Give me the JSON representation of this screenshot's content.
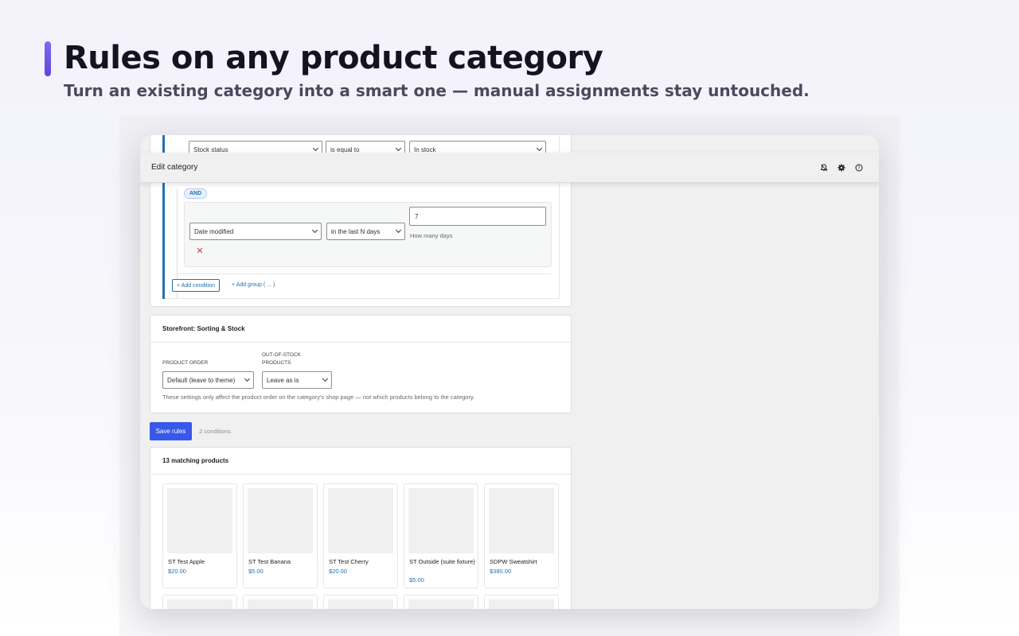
{
  "hero": {
    "title": "Rules on any product category",
    "subtitle": "Turn an existing category into a smart one — manual assignments stay untouched."
  },
  "topbar": {
    "title": "Edit category",
    "icons": [
      "bell-icon",
      "gear-icon",
      "help-icon"
    ]
  },
  "rules": {
    "condition1": {
      "field": "Stock status",
      "operator": "is equal to",
      "value": "In stock"
    },
    "and_label": "AND",
    "condition2": {
      "field": "Date modified",
      "operator": "in the last N days",
      "value": "7",
      "help": "How many days"
    },
    "add_condition": "+ Add condition",
    "add_group": "+ Add group ( ... )"
  },
  "storefront": {
    "heading": "Storefront: Sorting & Stock",
    "product_order_label": "PRODUCT ORDER",
    "product_order_value": "Default (leave to theme)",
    "oos_label_line1": "OUT-OF-STOCK",
    "oos_label_line2": "PRODUCTS",
    "oos_value": "Leave as is",
    "note": "These settings only affect the product order on the category's shop page — not which products belong to the category."
  },
  "save": {
    "button": "Save rules",
    "count": "2 conditions"
  },
  "matches": {
    "heading": "13 matching products",
    "products": [
      {
        "name": "ST Test Apple",
        "price": "$20.00"
      },
      {
        "name": "ST Test Banana",
        "price": "$5.00"
      },
      {
        "name": "ST Test Cherry",
        "price": "$20.00"
      },
      {
        "name": "ST Outside (suite fixture)",
        "price": "$5.00"
      },
      {
        "name": "SDPW Sweatshirt",
        "price": "$380.00"
      }
    ]
  },
  "colors": {
    "accent": "#3858e9",
    "link": "#2271b1",
    "hero_bar": "#6b5ae6"
  }
}
